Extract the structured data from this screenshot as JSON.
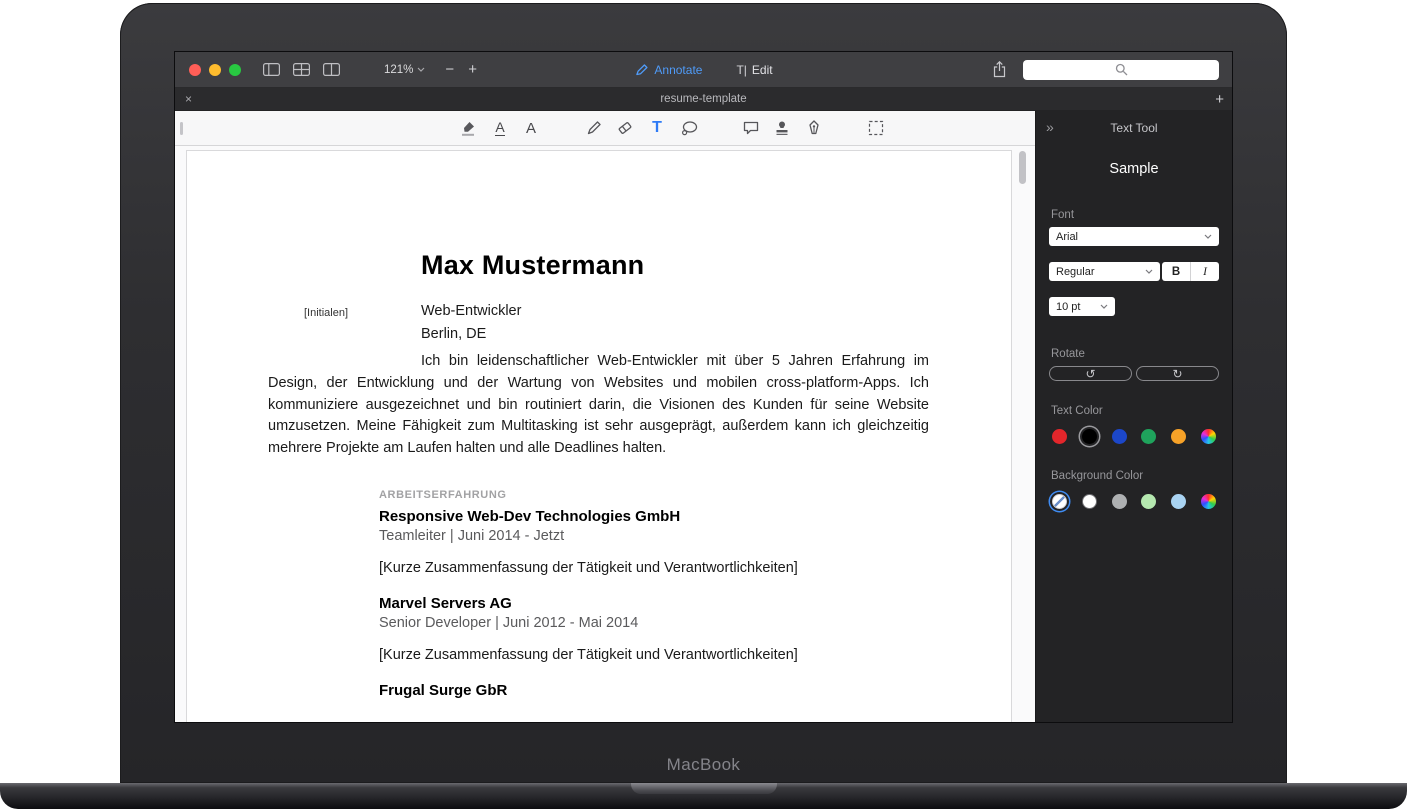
{
  "device": {
    "brand": "MacBook"
  },
  "window": {
    "titlebar": {
      "zoom": "121%",
      "zoom_out": "−",
      "zoom_in": "+",
      "annotate": "Annotate",
      "edit": "Edit",
      "edit_glyph": "T|"
    },
    "tabbar": {
      "close": "×",
      "title": "resume-template",
      "new_tab": "+"
    }
  },
  "toolbar": {
    "tools": [
      "text-highlight",
      "text-underline",
      "text-style",
      "pen",
      "eraser",
      "text",
      "shape",
      "note",
      "stamp",
      "signature",
      "select"
    ],
    "active_tool": "text",
    "text_tool_glyph": "T",
    "underline_glyph": "A",
    "style_glyph": "A"
  },
  "sidebar": {
    "collapse": "»",
    "title": "Text Tool",
    "sample": "Sample",
    "font_label": "Font",
    "font": "Arial",
    "style": "Regular",
    "bold": "B",
    "italic": "I",
    "size": "10 pt",
    "rotate_label": "Rotate",
    "rotate_left": "↺",
    "rotate_right": "↻",
    "text_color_label": "Text Color",
    "text_colors": [
      "#e3262b",
      "#000000",
      "#1c47c9",
      "#1fa35c",
      "#f7a228",
      "multicolor"
    ],
    "selected_text_color": "#000000",
    "background_color_label": "Background Color",
    "background_colors": [
      "none",
      "#ffffff",
      "#aeb0b2",
      "#b5e8b0",
      "#a9d3f2",
      "multicolor"
    ],
    "selected_background_color": "none"
  },
  "document": {
    "name": "Max Mustermann",
    "initials_placeholder": "[Initialen]",
    "role": "Web-Entwickler",
    "location": "Berlin, DE",
    "summary": "Ich bin leidenschaftlicher Web-Entwickler mit über 5 Jahren Erfahrung im Design, der Entwicklung und der Wartung von Websites und mobilen cross-platform-Apps. Ich kommuniziere ausgezeichnet und bin routiniert darin, die Visionen des Kunden für seine Website umzusetzen. Meine Fähigkeit zum Multitasking ist sehr ausgeprägt, außerdem kann ich gleichzeitig mehrere Projekte am Laufen halten und alle Deadlines halten.",
    "section_experience": "ARBEITSERFAHRUNG",
    "jobs": [
      {
        "company": "Responsive Web-Dev Technologies GmbH",
        "meta": "Teamleiter | Juni 2014 - Jetzt",
        "placeholder": "[Kurze Zusammenfassung der Tätigkeit und Verantwortlichkeiten]"
      },
      {
        "company": "Marvel Servers AG",
        "meta": "Senior Developer | Juni 2012 - Mai 2014",
        "placeholder": "[Kurze Zusammenfassung der Tätigkeit und Verantwortlichkeiten]"
      },
      {
        "company": "Frugal Surge GbR"
      }
    ]
  }
}
